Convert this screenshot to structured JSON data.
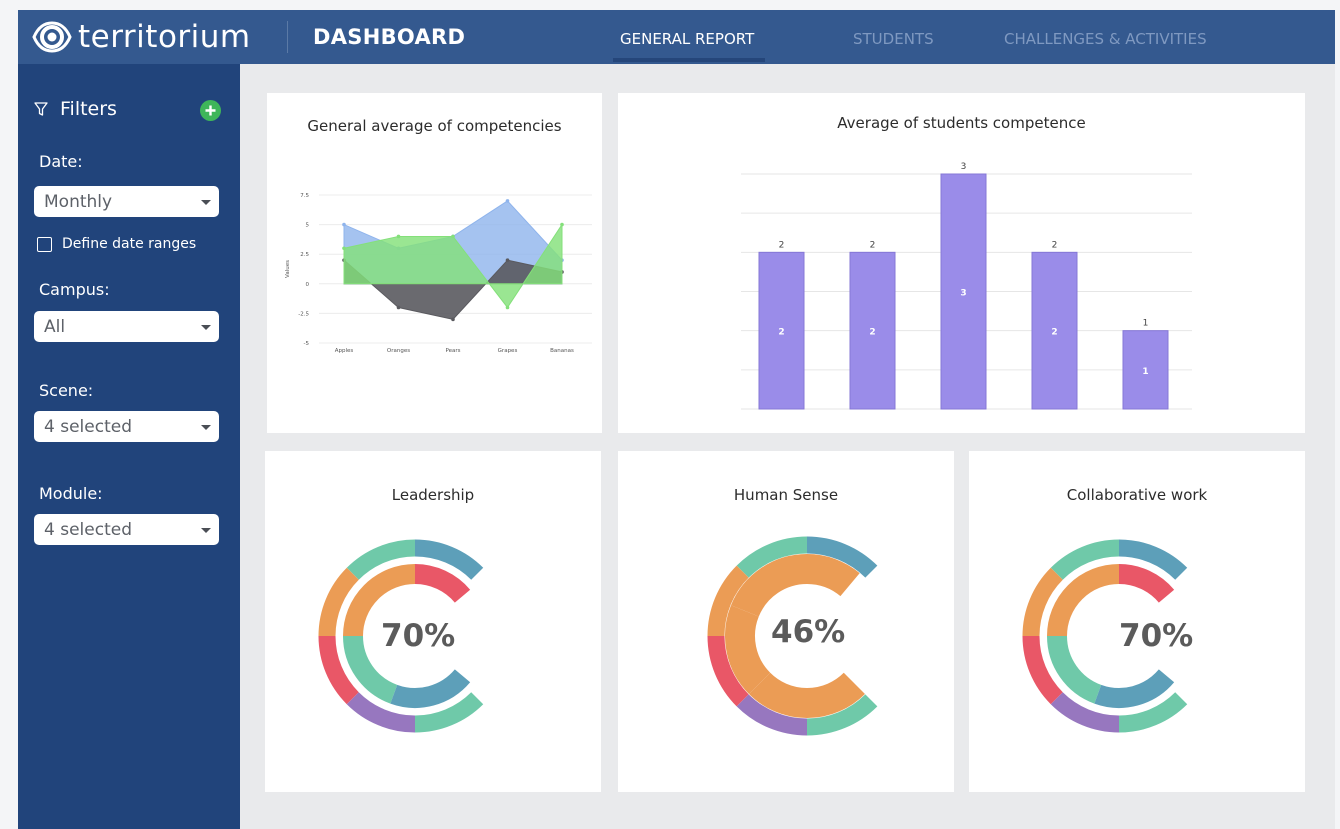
{
  "brand": {
    "name": "territorium"
  },
  "header": {
    "title": "DASHBOARD"
  },
  "tabs": [
    {
      "label": "GENERAL REPORT",
      "active": true
    },
    {
      "label": "STUDENTS",
      "active": false
    },
    {
      "label": "CHALLENGES & ACTIVITIES",
      "active": false
    }
  ],
  "sidebar": {
    "title": "Filters",
    "date_label": "Date:",
    "date_value": "Monthly",
    "define_ranges_label": "Define date ranges",
    "campus_label": "Campus:",
    "campus_value": "All",
    "scene_label": "Scene:",
    "scene_value": "4 selected",
    "module_label": "Module:",
    "module_value": "4 selected"
  },
  "colors": {
    "header_bg": "#34598f",
    "sidebar_bg": "#21447b",
    "bar_color": "#9a8ce9",
    "add_button": "#3fb65a",
    "ring_teal": "#6fc9a9",
    "ring_blue": "#5d9fb9",
    "ring_red": "#e95767",
    "ring_orange": "#eb9c55",
    "ring_purple": "#9777bf"
  },
  "chart_data": [
    {
      "type": "area",
      "title": "General average of competencies",
      "ylabel": "Values",
      "categories": [
        "Apples",
        "Oranges",
        "Pears",
        "Grapes",
        "Bananas"
      ],
      "ylim": [
        -5,
        7.5
      ],
      "yticks": [
        "7.5",
        "5",
        "2.5",
        "0",
        "-2.5",
        "-5"
      ],
      "series": [
        {
          "color": "#8fb4ec",
          "values": [
            5,
            3,
            4,
            7,
            2
          ]
        },
        {
          "color": "#5a5a5f",
          "values": [
            2,
            -2,
            -3,
            2,
            1
          ]
        },
        {
          "color": "#84e07a",
          "values": [
            3,
            4,
            4,
            -2,
            5
          ]
        }
      ]
    },
    {
      "type": "bar",
      "title": "Average of students competence",
      "values": [
        2,
        2,
        3,
        2,
        1
      ],
      "ylim": [
        0,
        3
      ]
    }
  ],
  "gauges": [
    {
      "title": "Leadership",
      "value": "70%"
    },
    {
      "title": "Human Sense",
      "value": "46%"
    },
    {
      "title": "Collaborative work",
      "value": "70%"
    }
  ]
}
